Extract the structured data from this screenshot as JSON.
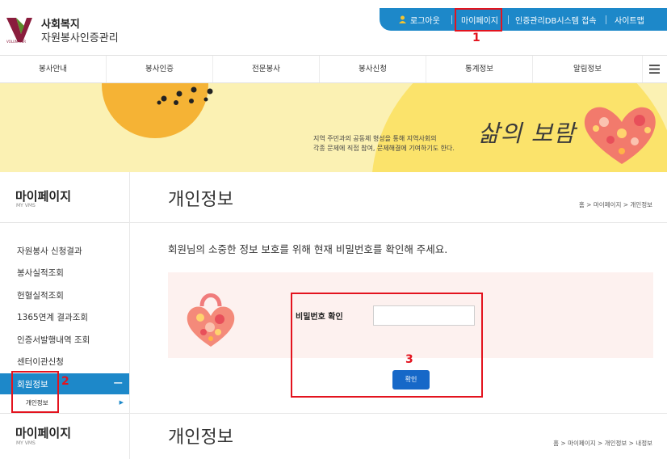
{
  "header": {
    "logo_line1": "사회복지",
    "logo_line2": "자원봉사인증관리",
    "logo_tag": "VOLUNTEER"
  },
  "topbar": {
    "logout": "로그아웃",
    "mypage": "마이페이지",
    "db_access": "인증관리DB시스템 접속",
    "sitemap": "사이트맵"
  },
  "nav": {
    "items": [
      "봉사안내",
      "봉사인증",
      "전문봉사",
      "봉사신청",
      "통계정보",
      "알림정보"
    ]
  },
  "banner": {
    "text_line1": "지역 주민과의 공동체 형성을 통해 지역사회의",
    "text_line2": "각종 문제에 직접 참여, 문제해결에 기여하기도 한다.",
    "title": "삶의 보람"
  },
  "sidebar": {
    "title": "마이페이지",
    "subtitle": "MY VMS",
    "items": [
      "자원봉사 신청결과",
      "봉사실적조회",
      "헌혈실적조회",
      "1365연계 결과조회",
      "인증서발행내역 조회",
      "센터이관신청"
    ],
    "active": "회원정보",
    "active_toggle": "−",
    "sub_item": "개인정보",
    "second_title": "마이페이지",
    "second_subtitle": "MY VMS"
  },
  "content": {
    "title": "개인정보",
    "breadcrumb": "홈 > 마이페이지 > 개인정보",
    "notice": "회원님의 소중한 정보 보호를 위해 현재 비밀번호를 확인해 주세요.",
    "password_label": "비밀번호 확인",
    "password_value": "",
    "confirm_label": "확인",
    "second_title": "개인정보",
    "second_breadcrumb": "홈 > 마이페이지 > 개인정보 > 내정보"
  },
  "annotations": [
    "1",
    "2",
    "3"
  ],
  "colors": {
    "accent_blue": "#1d88c9",
    "button_blue": "#1668c8",
    "annotation_red": "#e3131e",
    "banner_bg": "#fbf1b3",
    "box_bg": "#fdf1ef"
  },
  "icons": [
    "user-icon",
    "hamburger-menu-icon",
    "chevron-right-icon",
    "heart-illustration-icon"
  ]
}
